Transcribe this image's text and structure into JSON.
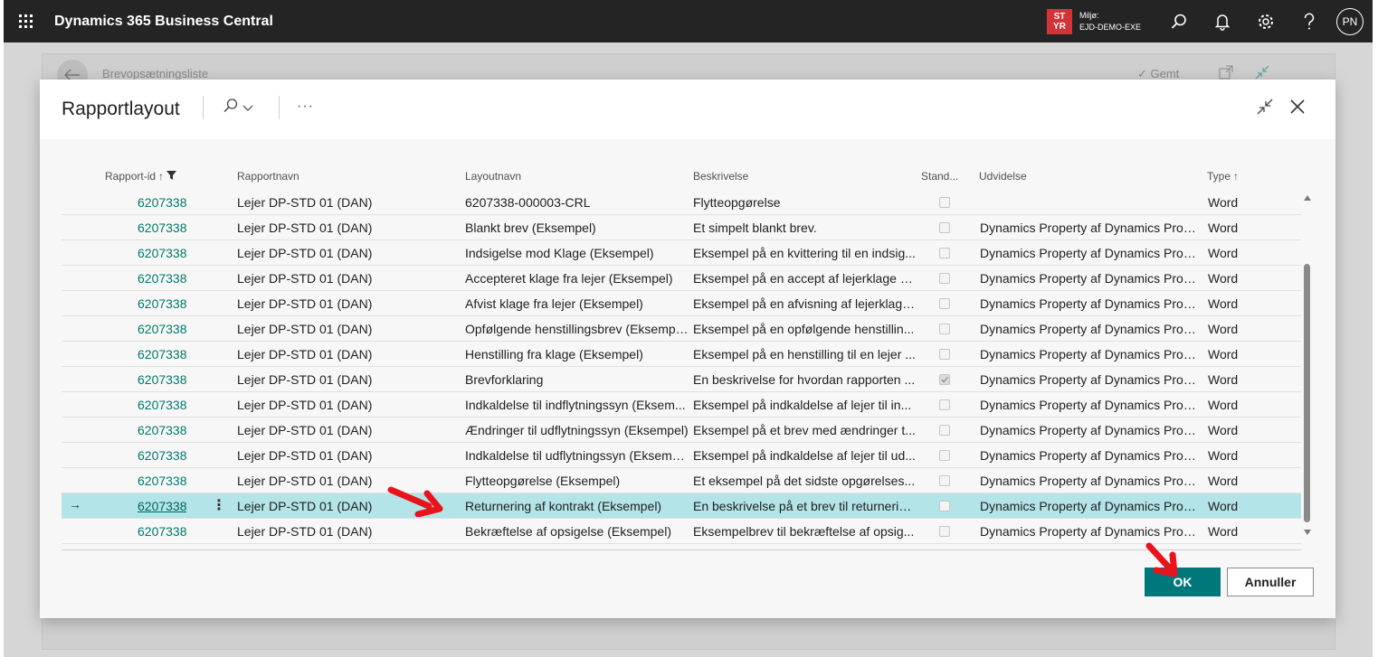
{
  "app": {
    "title": "Dynamics 365 Business Central",
    "env_badge_line1": "ST",
    "env_badge_line2": "YR",
    "env_label": "Miljø:",
    "env_name": "EJD-DEMO-EXE",
    "avatar_initials": "PN",
    "icons": [
      "waffle-icon",
      "search-icon",
      "bell-icon",
      "gear-icon",
      "help-icon"
    ]
  },
  "background_page": {
    "title": "Brevopsætningsliste",
    "saved_label": "Gemt"
  },
  "dialog": {
    "title": "Rapportlayout",
    "more_label": "···",
    "columns": {
      "report_id": "Rapport-id",
      "report_name": "Rapportnavn",
      "layout_name": "Layoutnavn",
      "description": "Beskrivelse",
      "standard": "Stand...",
      "extension": "Udvidelse",
      "type": "Type"
    },
    "rows": [
      {
        "id": "6207338",
        "name": "Lejer DP-STD 01 (DAN)",
        "layout": "6207338-000003-CRL",
        "desc": "Flytteopgørelse",
        "standard": false,
        "ext": "",
        "type": "Word"
      },
      {
        "id": "6207338",
        "name": "Lejer DP-STD 01 (DAN)",
        "layout": "Blankt brev (Eksempel)",
        "desc": "Et simpelt blankt brev.",
        "standard": false,
        "ext": "Dynamics Property af Dynamics Prop...",
        "type": "Word"
      },
      {
        "id": "6207338",
        "name": "Lejer DP-STD 01 (DAN)",
        "layout": "Indsigelse mod Klage (Eksempel)",
        "desc": "Eksempel på en kvittering til en indsig...",
        "standard": false,
        "ext": "Dynamics Property af Dynamics Prop...",
        "type": "Word"
      },
      {
        "id": "6207338",
        "name": "Lejer DP-STD 01 (DAN)",
        "layout": "Accepteret klage fra lejer (Eksempel)",
        "desc": "Eksempel på en accept af lejerklage s...",
        "standard": false,
        "ext": "Dynamics Property af Dynamics Prop...",
        "type": "Word"
      },
      {
        "id": "6207338",
        "name": "Lejer DP-STD 01 (DAN)",
        "layout": "Afvist klage fra lejer (Eksempel)",
        "desc": "Eksempel på en afvisning af lejerklage...",
        "standard": false,
        "ext": "Dynamics Property af Dynamics Prop...",
        "type": "Word"
      },
      {
        "id": "6207338",
        "name": "Lejer DP-STD 01 (DAN)",
        "layout": "Opfølgende henstillingsbrev (Eksempel)",
        "desc": "Eksempel på en opfølgende henstillin...",
        "standard": false,
        "ext": "Dynamics Property af Dynamics Prop...",
        "type": "Word"
      },
      {
        "id": "6207338",
        "name": "Lejer DP-STD 01 (DAN)",
        "layout": "Henstilling fra klage (Eksempel)",
        "desc": "Eksempel på en henstilling til en lejer ...",
        "standard": false,
        "ext": "Dynamics Property af Dynamics Prop...",
        "type": "Word"
      },
      {
        "id": "6207338",
        "name": "Lejer DP-STD 01 (DAN)",
        "layout": "Brevforklaring",
        "desc": "En beskrivelse for hvordan rapporten ...",
        "standard": true,
        "ext": "Dynamics Property af Dynamics Prop...",
        "type": "Word"
      },
      {
        "id": "6207338",
        "name": "Lejer DP-STD 01 (DAN)",
        "layout": "Indkaldelse til indflytningssyn (Eksem...",
        "desc": "Eksempel på indkaldelse af lejer til in...",
        "standard": false,
        "ext": "Dynamics Property af Dynamics Prop...",
        "type": "Word"
      },
      {
        "id": "6207338",
        "name": "Lejer DP-STD 01 (DAN)",
        "layout": "Ændringer til udflytningssyn (Eksempel)",
        "desc": "Eksempel på et brev med ændringer t...",
        "standard": false,
        "ext": "Dynamics Property af Dynamics Prop...",
        "type": "Word"
      },
      {
        "id": "6207338",
        "name": "Lejer DP-STD 01 (DAN)",
        "layout": "Indkaldelse til udflytningssyn (Eksemp...",
        "desc": "Eksempel på indkaldelse af lejer til ud...",
        "standard": false,
        "ext": "Dynamics Property af Dynamics Prop...",
        "type": "Word"
      },
      {
        "id": "6207338",
        "name": "Lejer DP-STD 01 (DAN)",
        "layout": "Flytteopgørelse (Eksempel)",
        "desc": "Et eksempel på det sidste opgørelses...",
        "standard": false,
        "ext": "Dynamics Property af Dynamics Prop...",
        "type": "Word"
      },
      {
        "id": "6207338",
        "name": "Lejer DP-STD 01 (DAN)",
        "layout": "Returnering af kontrakt (Eksempel)",
        "desc": "En beskrivelse på et brev til returnerin...",
        "standard": false,
        "ext": "Dynamics Property af Dynamics Prop...",
        "type": "Word",
        "selected": true
      },
      {
        "id": "6207338",
        "name": "Lejer DP-STD 01 (DAN)",
        "layout": "Bekræftelse af opsigelse (Eksempel)",
        "desc": "Eksempelbrev til bekræftelse af opsig...",
        "standard": false,
        "ext": "Dynamics Property af Dynamics Prop...",
        "type": "Word"
      }
    ],
    "selected_row_arrow": "→",
    "selected_row_menu": "⋮",
    "ok_label": "OK",
    "cancel_label": "Annuller"
  },
  "colors": {
    "accent": "#00777a",
    "link": "#00796b",
    "selected_row": "#b2e4e8",
    "annotation": "#e8141c",
    "appbar": "#242424",
    "env_badge": "#d13438"
  }
}
